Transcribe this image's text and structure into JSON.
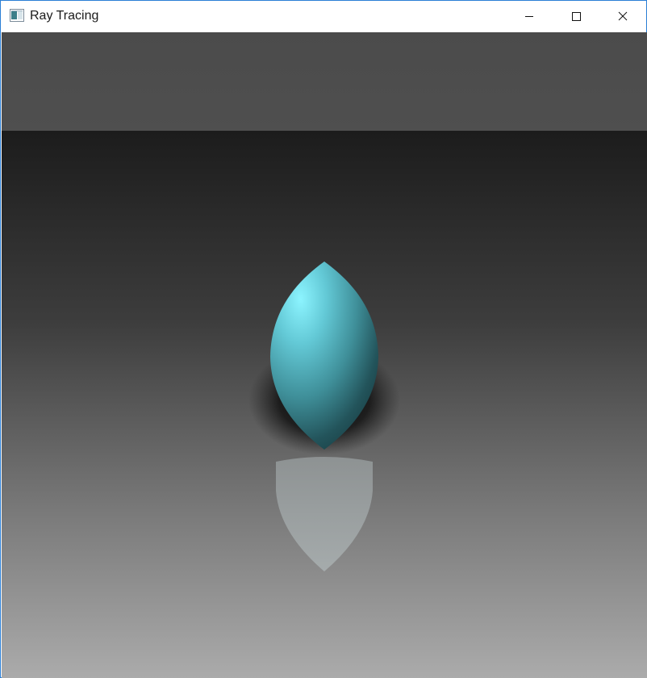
{
  "window": {
    "title": "Ray Tracing",
    "icons": {
      "app": "app-window-icon",
      "minimize": "minimize-icon",
      "maximize": "maximize-icon",
      "close": "close-icon"
    }
  },
  "scene": {
    "object": "ellipsoid-lens-shape",
    "object_color": "#79e6f2",
    "background_color": "#4a4a4a",
    "floor_color_near": "#a9a9a9",
    "floor_color_far": "#1c1c1c"
  }
}
